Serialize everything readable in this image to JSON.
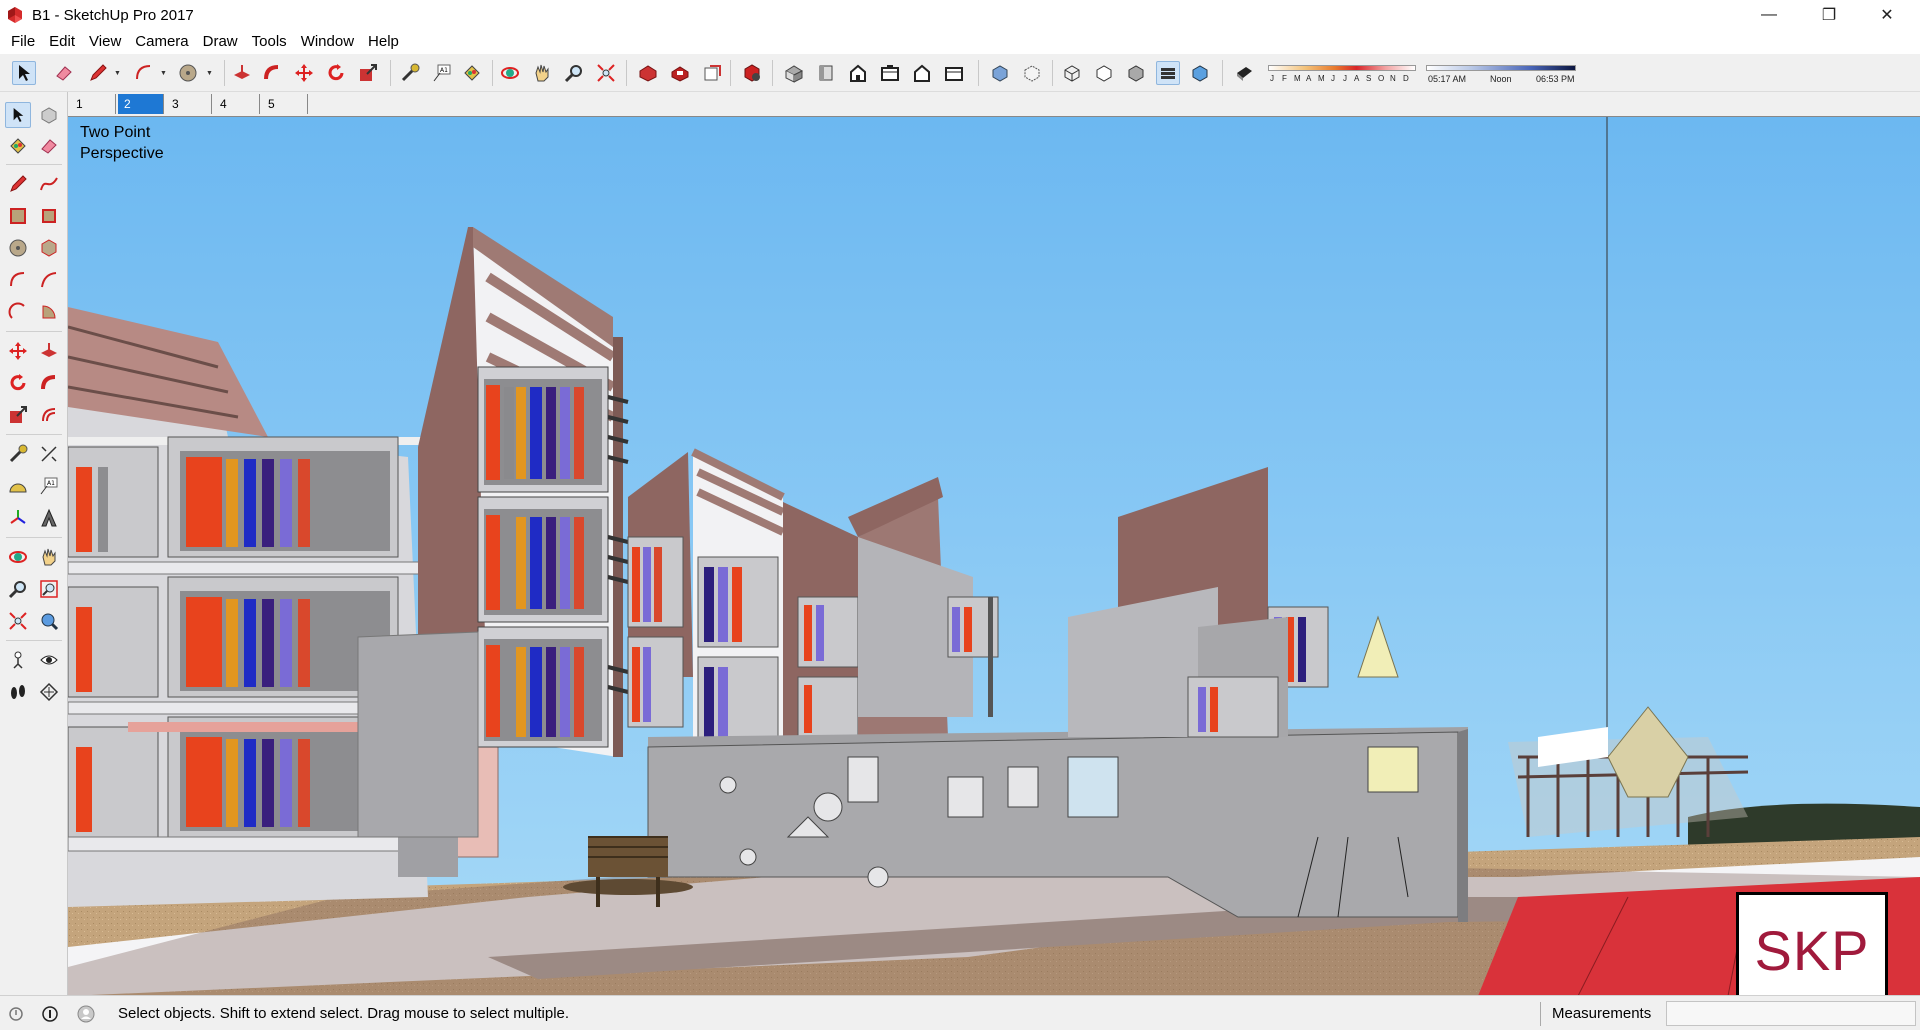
{
  "window": {
    "title": "B1 - SketchUp Pro 2017",
    "controls": [
      "minimize-icon",
      "restore-icon",
      "close-icon"
    ]
  },
  "menu": [
    "File",
    "Edit",
    "View",
    "Camera",
    "Draw",
    "Tools",
    "Window",
    "Help"
  ],
  "toolbar": {
    "icons": [
      "select-icon",
      "eraser-icon",
      "pencil-icon",
      "arc-icon",
      "circle-icon",
      "push-pull-icon",
      "follow-me-icon",
      "move-icon",
      "rotate-icon",
      "scale-icon",
      "tape-measure-icon",
      "text-icon",
      "paint-bucket-icon",
      "orbit-icon",
      "pan-icon",
      "zoom-icon",
      "zoom-extents-icon",
      "3d-warehouse-icon",
      "extension-warehouse-icon",
      "layout-icon",
      "extension-manager-icon",
      "iso-view-icon",
      "top-view-icon",
      "front-view-icon",
      "right-view-icon",
      "back-view-icon",
      "left-view-icon",
      "xray-icon",
      "back-edges-icon",
      "wireframe-icon",
      "hidden-line-icon",
      "shaded-icon",
      "shaded-textures-icon",
      "monochrome-icon",
      "shadows-icon"
    ],
    "months": [
      "J",
      "F",
      "M",
      "A",
      "M",
      "J",
      "J",
      "A",
      "S",
      "O",
      "N",
      "D"
    ],
    "time": {
      "start": "05:17 AM",
      "noon": "Noon",
      "end": "06:53 PM"
    }
  },
  "scene_tabs": [
    {
      "label": "1",
      "active": false
    },
    {
      "label": "2",
      "active": true
    },
    {
      "label": "3",
      "active": false
    },
    {
      "label": "4",
      "active": false
    },
    {
      "label": "5",
      "active": false
    }
  ],
  "left_palette": [
    "select-icon",
    "make-component-icon",
    "paint-bucket-icon",
    "eraser-icon",
    "line-icon",
    "freehand-icon",
    "rectangle-icon",
    "rotated-rectangle-icon",
    "circle-icon",
    "polygon-icon",
    "arc-icon",
    "two-point-arc-icon",
    "three-point-arc-icon",
    "pie-icon",
    "move-icon",
    "push-pull-icon",
    "rotate-icon",
    "follow-me-icon",
    "scale-icon",
    "offset-icon",
    "tape-measure-icon",
    "dimension-icon",
    "protractor-icon",
    "text-icon",
    "axes-icon",
    "3d-text-icon",
    "orbit-icon",
    "pan-icon",
    "zoom-icon",
    "zoom-window-icon",
    "zoom-extents-icon",
    "previous-view-icon",
    "position-camera-icon",
    "look-around-icon",
    "walk-icon",
    "section-plane-icon"
  ],
  "viewport": {
    "camera_label": "Two Point\nPerspective",
    "colors": {
      "sky_top": "#6fb9f0",
      "sky_bottom": "#a9dbf7",
      "wall": "#9b6e68",
      "slab": "#d5d5d8",
      "ground": "#c2a27a",
      "red_plaza": "#d9323a"
    }
  },
  "badge": {
    "text": "SKP"
  },
  "status": {
    "message": "Select objects. Shift to extend select. Drag mouse to select multiple.",
    "measurements_label": "Measurements",
    "measurements_value": ""
  }
}
